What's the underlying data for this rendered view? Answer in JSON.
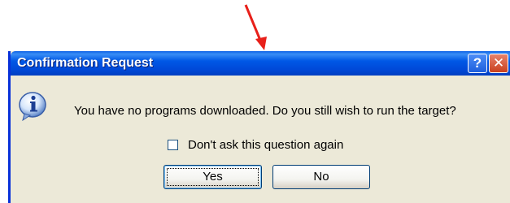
{
  "annotation": {
    "arrow_color": "#e8201a"
  },
  "dialog": {
    "title": "Confirmation Request",
    "titlebar_buttons": {
      "help_label": "?",
      "close_label": "✕"
    },
    "icon": "info-icon",
    "message": "You have no programs downloaded. Do you still wish to run the target?",
    "checkbox": {
      "label": "Don't ask this question again",
      "checked": false
    },
    "buttons": {
      "yes_label": "Yes",
      "no_label": "No"
    }
  },
  "colors": {
    "titlebar": "#0058e6",
    "dialog_bg": "#ece9d8",
    "close_button": "#c9401e"
  }
}
